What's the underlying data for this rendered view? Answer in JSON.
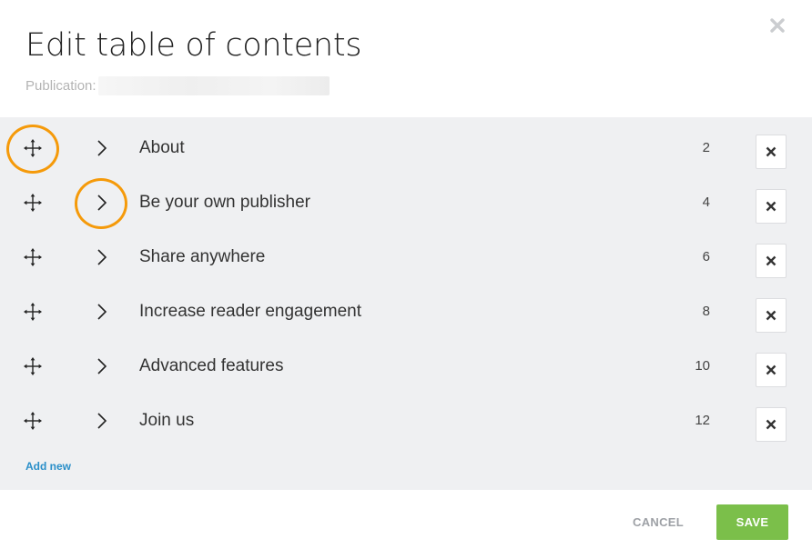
{
  "dialog": {
    "title": "Edit table of contents",
    "publication_label": "Publication:"
  },
  "toc": {
    "entries": [
      {
        "title": "About",
        "page": "2"
      },
      {
        "title": "Be your own publisher",
        "page": "4"
      },
      {
        "title": "Share anywhere",
        "page": "6"
      },
      {
        "title": "Increase reader engagement",
        "page": "8"
      },
      {
        "title": "Advanced features",
        "page": "10"
      },
      {
        "title": "Join us",
        "page": "12"
      }
    ],
    "add_new_label": "Add new"
  },
  "footer": {
    "cancel_label": "CANCEL",
    "save_label": "SAVE"
  },
  "colors": {
    "highlight_ring": "#f59a0a",
    "save_button": "#7bbf4a",
    "add_link": "#2a8fc9",
    "panel_background": "#eff0f2"
  },
  "icons": {
    "drag": "move-arrows-icon",
    "expand": "chevron-right-icon",
    "delete": "close-icon"
  }
}
